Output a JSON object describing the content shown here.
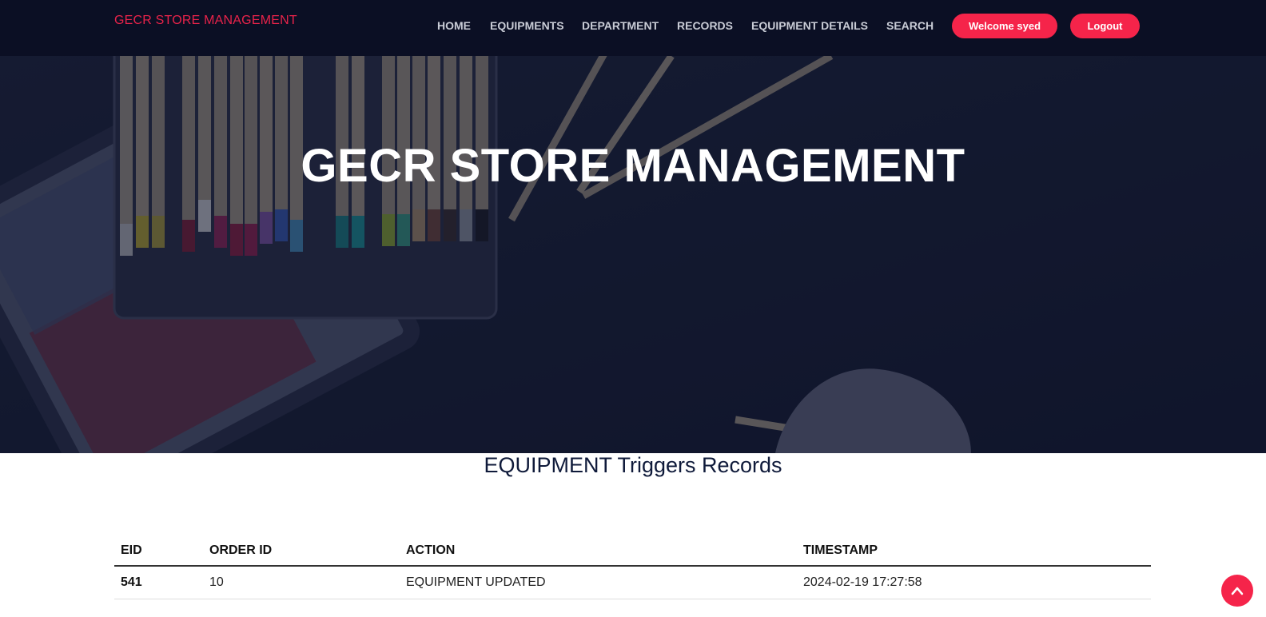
{
  "brand": "GECR STORE MANAGEMENT",
  "nav": {
    "links": [
      "HOME",
      "EQUIPMENTS",
      "DEPARTMENT",
      "RECORDS",
      "EQUIPMENT DETAILS",
      "SEARCH"
    ],
    "welcome": "Welcome syed",
    "logout": "Logout"
  },
  "hero": {
    "title": "GECR STORE MANAGEMENT"
  },
  "section": {
    "title": "EQUIPMENT Triggers Records"
  },
  "table": {
    "headers": [
      "EID",
      "ORDER ID",
      "ACTION",
      "TIMESTAMP"
    ],
    "rows": [
      [
        "541",
        "10",
        "EQUIPMENT UPDATED",
        "2024-02-19 17:27:58"
      ]
    ]
  },
  "icons": {
    "scroll_top": "chevron-up-icon"
  },
  "colors": {
    "accent": "#f5244a",
    "nav_bg": "#0b0f24",
    "hero_bg": "#141a33",
    "brand": "#e8234a"
  }
}
